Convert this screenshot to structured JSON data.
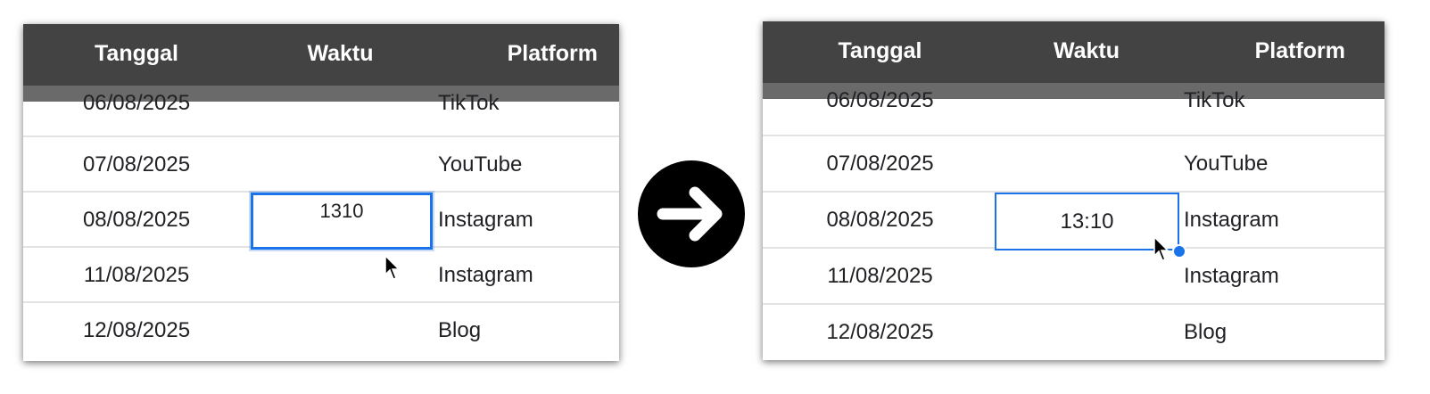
{
  "columns": {
    "date": "Tanggal",
    "time": "Waktu",
    "platform": "Platform"
  },
  "before": {
    "rows": [
      {
        "date": "06/08/2025",
        "time": "",
        "platform": "TikTok"
      },
      {
        "date": "07/08/2025",
        "time": "",
        "platform": "YouTube"
      },
      {
        "date": "08/08/2025",
        "time": "",
        "platform": "Instagram"
      },
      {
        "date": "11/08/2025",
        "time": "",
        "platform": "Instagram"
      },
      {
        "date": "12/08/2025",
        "time": "",
        "platform": "Blog"
      }
    ],
    "editing_value": "1310"
  },
  "after": {
    "rows": [
      {
        "date": "06/08/2025",
        "time": "",
        "platform": "TikTok"
      },
      {
        "date": "07/08/2025",
        "time": "",
        "platform": "YouTube"
      },
      {
        "date": "08/08/2025",
        "time": "",
        "platform": "Instagram"
      },
      {
        "date": "11/08/2025",
        "time": "",
        "platform": "Instagram"
      },
      {
        "date": "12/08/2025",
        "time": "",
        "platform": "Blog"
      }
    ],
    "selected_value": "13:10"
  },
  "colors": {
    "header_bg": "#434343",
    "subheader_bg": "#6a6a6a",
    "selection": "#1a73e8",
    "arrow_bg": "#000000"
  },
  "icons": {
    "transition": "arrow-right-icon",
    "pointer": "mouse-pointer-icon",
    "fill_handle": "fill-handle-icon"
  }
}
